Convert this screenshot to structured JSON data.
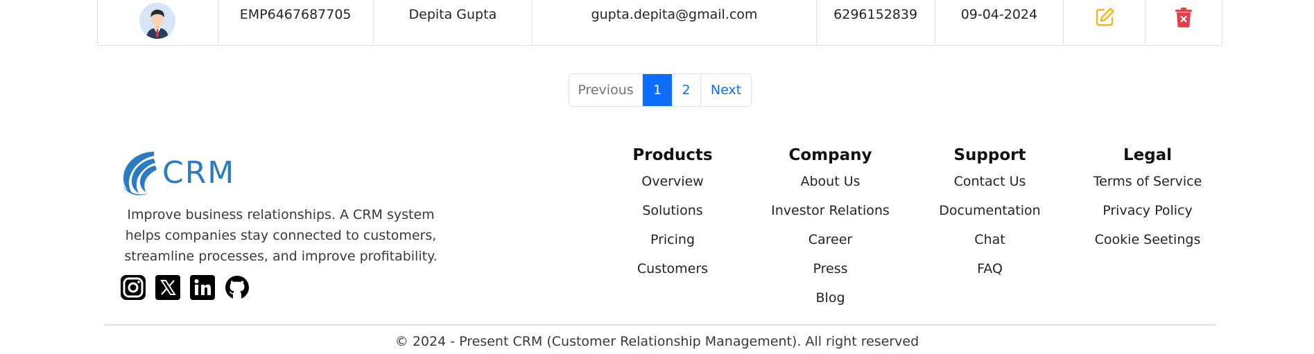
{
  "row": {
    "employee_id": "EMP6467687705",
    "name": "Depita Gupta",
    "email": "gupta.depita@gmail.com",
    "phone": "6296152839",
    "date": "09-04-2024",
    "avatar_icon": "user-avatar-icon",
    "edit_icon": "edit-icon",
    "delete_icon": "delete-icon"
  },
  "pagination": {
    "previous": "Previous",
    "pages": [
      "1",
      "2"
    ],
    "active_page": "1",
    "next": "Next"
  },
  "footer": {
    "brand": {
      "logo_text": "CRM",
      "description": "Improve business relationships. A CRM system helps companies stay connected to customers, streamline processes, and improve profitability.",
      "socials": [
        "instagram-icon",
        "x-twitter-icon",
        "linkedin-icon",
        "github-icon"
      ]
    },
    "columns": {
      "products": {
        "title": "Products",
        "links": [
          "Overview",
          "Solutions",
          "Pricing",
          "Customers"
        ]
      },
      "company": {
        "title": "Company",
        "links": [
          "About Us",
          "Investor Relations",
          "Career",
          "Press",
          "Blog"
        ]
      },
      "support": {
        "title": "Support",
        "links": [
          "Contact Us",
          "Documentation",
          "Chat",
          "FAQ"
        ]
      },
      "legal": {
        "title": "Legal",
        "links": [
          "Terms of Service",
          "Privacy Policy",
          "Cookie Seetings"
        ]
      }
    },
    "copyright": "© 2024 - Present CRM (Customer Relationship Management). All right reserved"
  },
  "colors": {
    "primary": "#0d6efd",
    "edit": "#f5b51f",
    "delete": "#e0414b",
    "brand": "#2a7bc4"
  }
}
